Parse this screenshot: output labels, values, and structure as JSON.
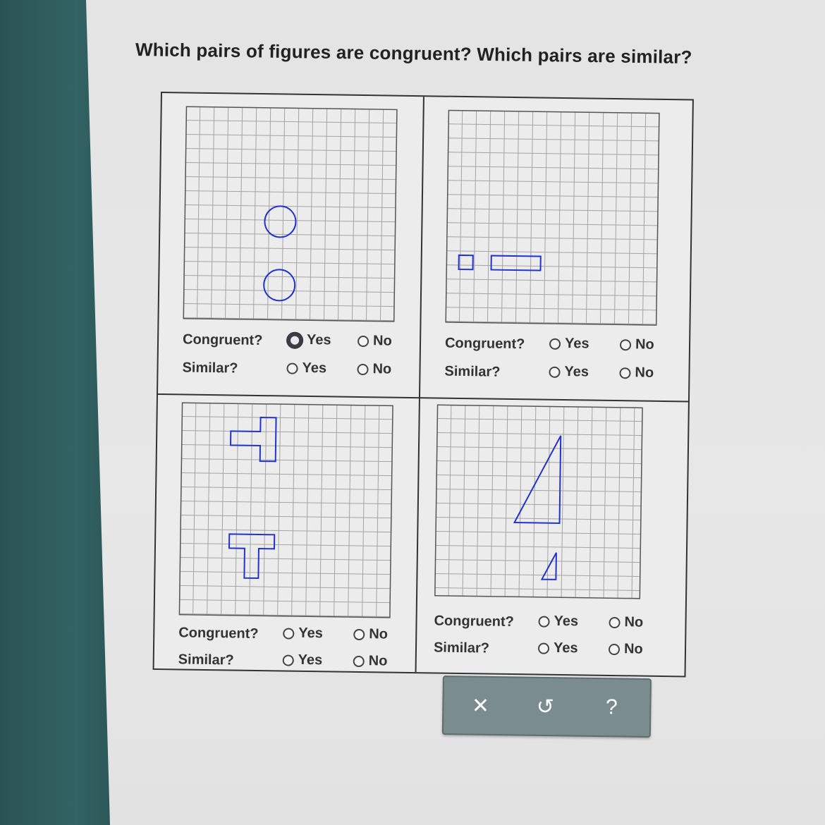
{
  "question": "Which pairs of figures are congruent? Which pairs are similar?",
  "labels": {
    "congruent": "Congruent?",
    "similar": "Similar?",
    "yes": "Yes",
    "no": "No"
  },
  "pairs": [
    {
      "figures": "circles",
      "congruent_selected": "Yes",
      "similar_selected": null
    },
    {
      "figures": "rectangles",
      "congruent_selected": null,
      "similar_selected": null
    },
    {
      "figures": "t-shapes",
      "congruent_selected": null,
      "similar_selected": null
    },
    {
      "figures": "triangles",
      "congruent_selected": null,
      "similar_selected": null
    }
  ],
  "toolbar": {
    "clear_glyph": "✕",
    "undo_glyph": "↺",
    "help_glyph": "?"
  },
  "colors": {
    "figure": "#2233cc",
    "grid": "#9a9a9a",
    "toolbar": "#7b8c8e"
  }
}
